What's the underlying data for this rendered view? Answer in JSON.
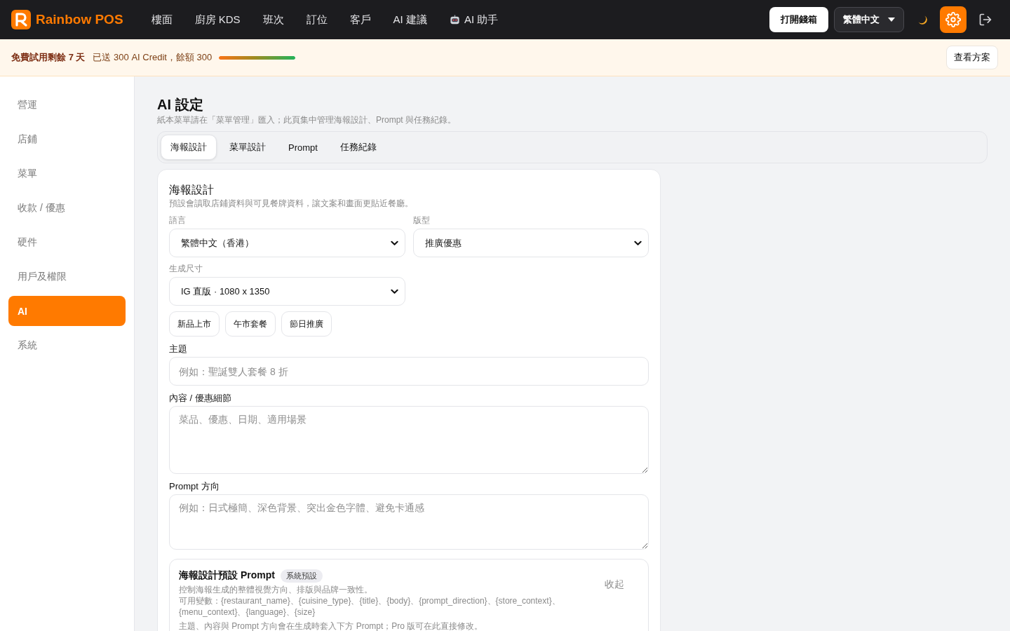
{
  "top_bar": {
    "brand": "Rainbow POS",
    "nav": [
      {
        "label": "樓面",
        "kind": "link"
      },
      {
        "label": "廚房 KDS",
        "kind": "link"
      },
      {
        "label": "班次",
        "kind": "link"
      },
      {
        "label": "訂位",
        "kind": "link"
      },
      {
        "label": "客戶",
        "kind": "link"
      },
      {
        "label": "AI 建議",
        "kind": "link"
      },
      {
        "label": "AI 助手",
        "kind": "assistant"
      }
    ],
    "cash_drawer_button": "打開錢箱",
    "language_select": "繁體中文"
  },
  "trial_banner": {
    "trial_text": "免費試用剩餘 **7** 天",
    "credit_text": "已送 300 AI Credit，餘額 300",
    "level": 1,
    "plan_button": "查看方案"
  },
  "sidebar": {
    "items": [
      {
        "label": "營運",
        "selected": false
      },
      {
        "label": "店鋪",
        "selected": false
      },
      {
        "label": "菜單",
        "selected": false
      },
      {
        "label": "收款 / 優惠",
        "selected": false
      },
      {
        "label": "硬件",
        "selected": false
      },
      {
        "label": "用戶及權限",
        "selected": false
      },
      {
        "label": "AI",
        "selected": true
      },
      {
        "label": "系統",
        "selected": false
      }
    ]
  },
  "page": {
    "title": "AI 設定",
    "subtitle": "紙本菜單請在「菜單管理」匯入；此頁集中管理海報設計、Prompt 與任務紀錄。"
  },
  "tabs": [
    {
      "label": "海報設計",
      "selected": true
    },
    {
      "label": "菜單設計",
      "selected": false
    },
    {
      "label": "Prompt",
      "selected": false
    },
    {
      "label": "任務紀錄",
      "selected": false
    }
  ],
  "poster_card": {
    "title": "海報設計",
    "description": "預設會讀取店鋪資料與可見餐牌資料，讓文案和畫面更貼近餐廳。",
    "selects": [
      {
        "label": "語言",
        "value": "繁體中文（香港）"
      },
      {
        "label": "版型",
        "value": "推廣優惠"
      },
      {
        "label": "生成尺寸",
        "value": "IG 直版 · 1080 x 1350"
      }
    ],
    "presets": [
      "新品上市",
      "午市套餐",
      "節日推廣"
    ],
    "inputs": [
      {
        "label": "主題",
        "kind": "input",
        "placeholder": "例如：聖誕雙人套餐 8 折"
      },
      {
        "label": "內容 / 優惠細節",
        "kind": "textarea",
        "placeholder": "菜品、優惠、日期、適用場景"
      },
      {
        "label": "Prompt 方向",
        "kind": "textarea",
        "placeholder": "例如：日式極簡、深色背景、突出金色字體、避免卡通感"
      }
    ],
    "prompt_panel": {
      "title": "海報設計預設 Prompt",
      "badge": "系統預設",
      "toggle": "收起",
      "lines": [
        "控制海報生成的整體視覺方向、排版與品牌一致性。",
        "可用變數：{restaurant_name}、{cuisine_type}、{title}、{body}、{prompt_direction}、{store_context}、{menu_context}、{language}、{size}"
      ],
      "note": "主題、內容與 Prompt 方向會在生成時套入下方 Prompt；Pro 版可在此直接修改。"
    }
  }
}
